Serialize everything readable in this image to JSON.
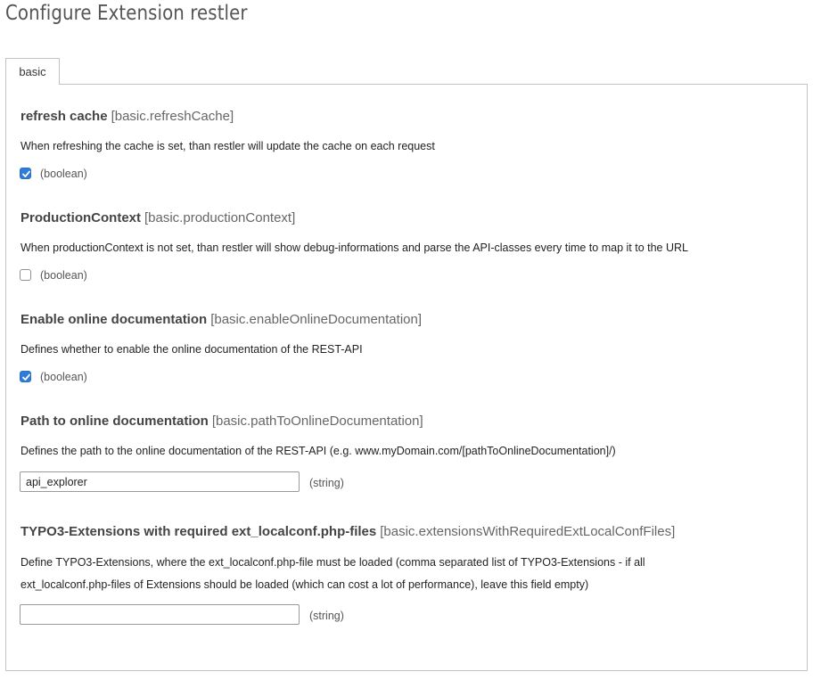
{
  "page": {
    "title": "Configure Extension restler"
  },
  "tabs": [
    {
      "label": "basic",
      "active": true
    }
  ],
  "fields": [
    {
      "label": "refresh cache",
      "key": "[basic.refreshCache]",
      "description": "When refreshing the cache is set, than restler will update the cache on each request",
      "type": "(boolean)",
      "checked": true
    },
    {
      "label": "ProductionContext",
      "key": "[basic.productionContext]",
      "description": "When productionContext is not set, than restler will show debug-informations and parse the API-classes every time to map it to the URL",
      "type": "(boolean)",
      "checked": false
    },
    {
      "label": "Enable online documentation",
      "key": "[basic.enableOnlineDocumentation]",
      "description": "Defines whether to enable the online documentation of the REST-API",
      "type": "(boolean)",
      "checked": true
    },
    {
      "label": "Path to online documentation",
      "key": "[basic.pathToOnlineDocumentation]",
      "description": "Defines the path to the online documentation of the REST-API (e.g. www.myDomain.com/[pathToOnlineDocumentation]/)",
      "type": "(string)",
      "value": "api_explorer"
    },
    {
      "label": "TYPO3-Extensions with required ext_localconf.php-files",
      "key": "[basic.extensionsWithRequiredExtLocalConfFiles]",
      "description_lines": [
        "Define TYPO3-Extensions, where the ext_localconf.php-file must be loaded (comma separated list of TYPO3-Extensions - if all",
        "ext_localconf.php-files of Extensions should be loaded (which can cost a lot of performance), leave this field empty)"
      ],
      "type": "(string)",
      "value": ""
    }
  ],
  "colors": {
    "checkbox_checked": "#2f7cd9",
    "heading": "#444444",
    "key": "#666666",
    "border": "#c3c3c3"
  },
  "icons": {
    "checkbox_checked": "checkmark-icon"
  }
}
